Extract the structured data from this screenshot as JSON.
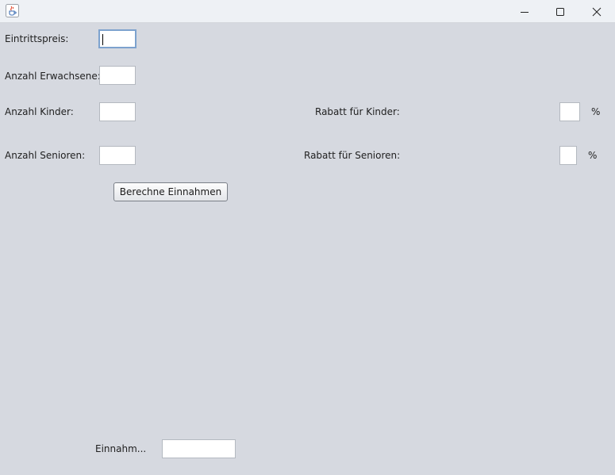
{
  "window": {
    "icon": "java-coffee-cup-icon",
    "controls": {
      "minimize": "minimize-icon",
      "maximize": "maximize-icon",
      "close": "close-icon"
    }
  },
  "form": {
    "eintrittspreis": {
      "label": "Eintrittspreis:",
      "value": ""
    },
    "erwachsene": {
      "label": "Anzahl Erwachsene:",
      "value": ""
    },
    "kinder": {
      "label": "Anzahl Kinder:",
      "value": ""
    },
    "senioren": {
      "label": "Anzahl Senioren:",
      "value": ""
    },
    "rabatt_kinder": {
      "label": "Rabatt für Kinder:",
      "value": "",
      "unit": "%"
    },
    "rabatt_senioren": {
      "label": "Rabatt für Senioren:",
      "value": "",
      "unit": "%"
    },
    "calculate_button": "Berechne Einnahmen",
    "einnahmen": {
      "label": "Einnahm...",
      "value": ""
    }
  }
}
